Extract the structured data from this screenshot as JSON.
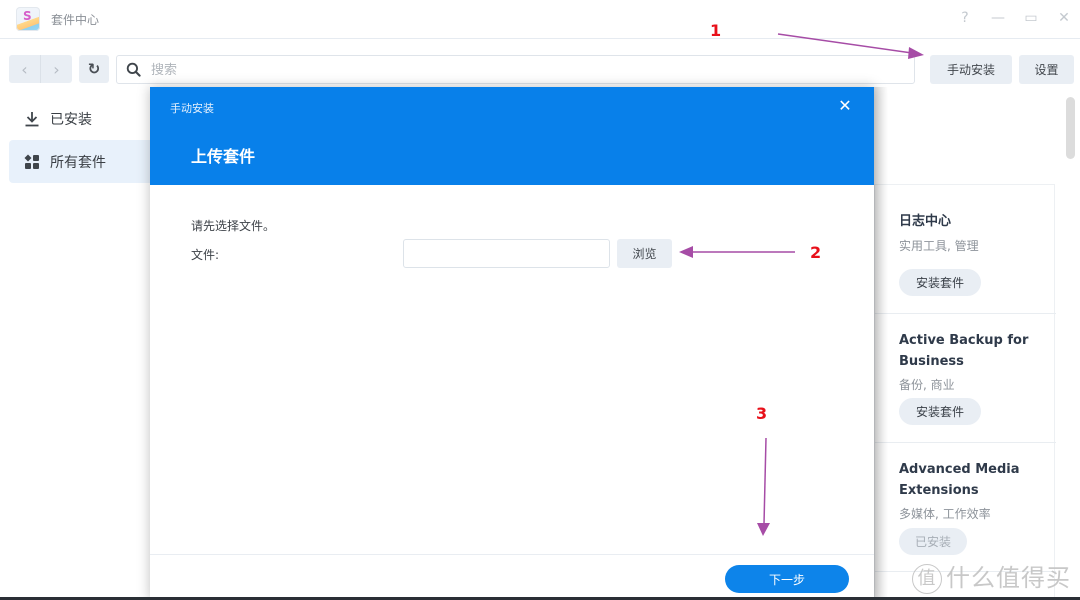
{
  "window": {
    "title": "套件中心",
    "controls": {
      "help": "?",
      "minimize": "—",
      "maximize": "▭",
      "close": "✕"
    }
  },
  "toolbar": {
    "back_icon": "‹",
    "forward_icon": "›",
    "refresh_icon": "↻",
    "search_placeholder": "搜索",
    "search_value": "",
    "manual_install_label": "手动安装",
    "settings_label": "设置"
  },
  "sidebar": {
    "items": [
      {
        "label": "已安装",
        "icon": "download-icon",
        "active": false
      },
      {
        "label": "所有套件",
        "icon": "grid-icon",
        "active": true
      }
    ]
  },
  "packages": [
    {
      "title": "日志中心",
      "category": "实用工具, 管理",
      "button": "安装套件",
      "installed": false
    },
    {
      "title": "Active Backup for Business",
      "category": "备份, 商业",
      "button": "安装套件",
      "installed": false
    },
    {
      "title": "Advanced Media Extensions",
      "category": "多媒体, 工作效率",
      "button": "已安装",
      "installed": true
    }
  ],
  "dialog": {
    "small_title": "手动安装",
    "close_icon": "✕",
    "big_title": "上传套件",
    "hint": "请先选择文件。",
    "file_label": "文件:",
    "file_value": "",
    "browse_label": "浏览",
    "next_label": "下一步"
  },
  "annotations": {
    "colors": {
      "number": "#e8101a",
      "arrow": "#a64ca6"
    },
    "steps": [
      "1",
      "2",
      "3"
    ]
  },
  "watermark": {
    "badge": "值",
    "text": "什么值得买"
  },
  "colors": {
    "accent": "#0880ea",
    "button_bg": "#e9eef4",
    "active_sidebar_bg": "#e8f1fb"
  }
}
